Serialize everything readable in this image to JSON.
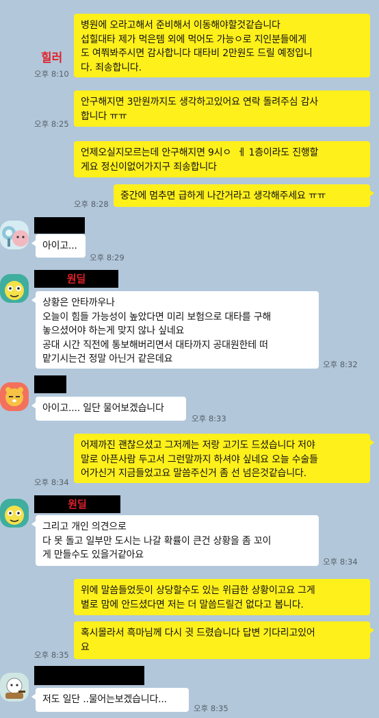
{
  "colors": {
    "background": "#b2c7da",
    "my_bubble": "#fef01b",
    "their_bubble": "#ffffff",
    "name_red": "#e0212a"
  },
  "sender_tag": "힐러",
  "messages": {
    "m1": {
      "text": "병원에 오라고해서 준비해서 이동해야할것같습니다\n섭힐대타 제가 먹은템 외에 먹어도 가능ㅇ로 지인분들에게\n도 여쭤봐주시면 감사합니다 대타비 2만원도 드릴 예정입니\n다. 죄송합니다.",
      "time": "오후 8:10"
    },
    "m2": {
      "text": "안구해지면 3만원까지도 생각하고있어요 연락 돌려주심 감사\n합니다 ㅠㅠ",
      "time": "오후 8:25"
    },
    "m3": {
      "text": "언제오실지모르는데 안구해지면 9시ㅇ  ㅔ 1층이라도 진행할\n게요 정신이없어가지구 죄송합니다"
    },
    "m4": {
      "text": "중간에 멈추면 급하게 나간거라고 생각해주세요 ㅠㅠ",
      "time": "오후 8:28"
    },
    "m5": {
      "sender": "",
      "text": "아이고...",
      "time": "오후 8:29"
    },
    "m6": {
      "sender": "원딜",
      "text": "상황은 안타까우나\n오늘이 힘들 가능성이 높았다면 미리 보험으로 대타를 구해\n놓으셨어야 하는게 맞지 않나 싶네요\n공대 시간 직전에 통보해버리면서 대타까지 공대원한테 떠\n맡기시는건 정말 아닌거 같은데요",
      "time": "오후 8:32"
    },
    "m7": {
      "sender": "",
      "text": "아이고.... 일단 물어보겠습니다",
      "time": "오후 8:33"
    },
    "m8": {
      "text": "어제까진 괜찮으셨고 그저께는 저랑 고기도 드셨습니다 저야\n말로 아픈사람 두고서 그런말까지 하셔야 싶네요 오늘 수술들\n어가신거 지금들었고요 말씀주신거 좀 선 넘은것같습니다.",
      "time": "오후 8:34"
    },
    "m9": {
      "sender": "원딜",
      "text": "그리고 개인 의견으로\n다 못 돌고 일부만 도시는 나갈 확률이 큰건 상황을 좀 꼬이\n게 만들수도 있을거같아요",
      "time": "오후 8:34"
    },
    "m10": {
      "text": "위에 말씀들었듯이 상당할수도 있는 위급한 상황이고요 그게\n별로 맘에 안드셨다면 저는 더 말씀드릴건 없다고 봅니다."
    },
    "m11": {
      "text": "혹시몰라서 흑마님께 다시 귓 드렸습니다 답변 기다리고있어\n요",
      "time": "오후 8:35"
    },
    "m12": {
      "sender": "",
      "text": "저도 일단 ..물어는보겠습니다...",
      "time": "오후 8:35"
    }
  }
}
